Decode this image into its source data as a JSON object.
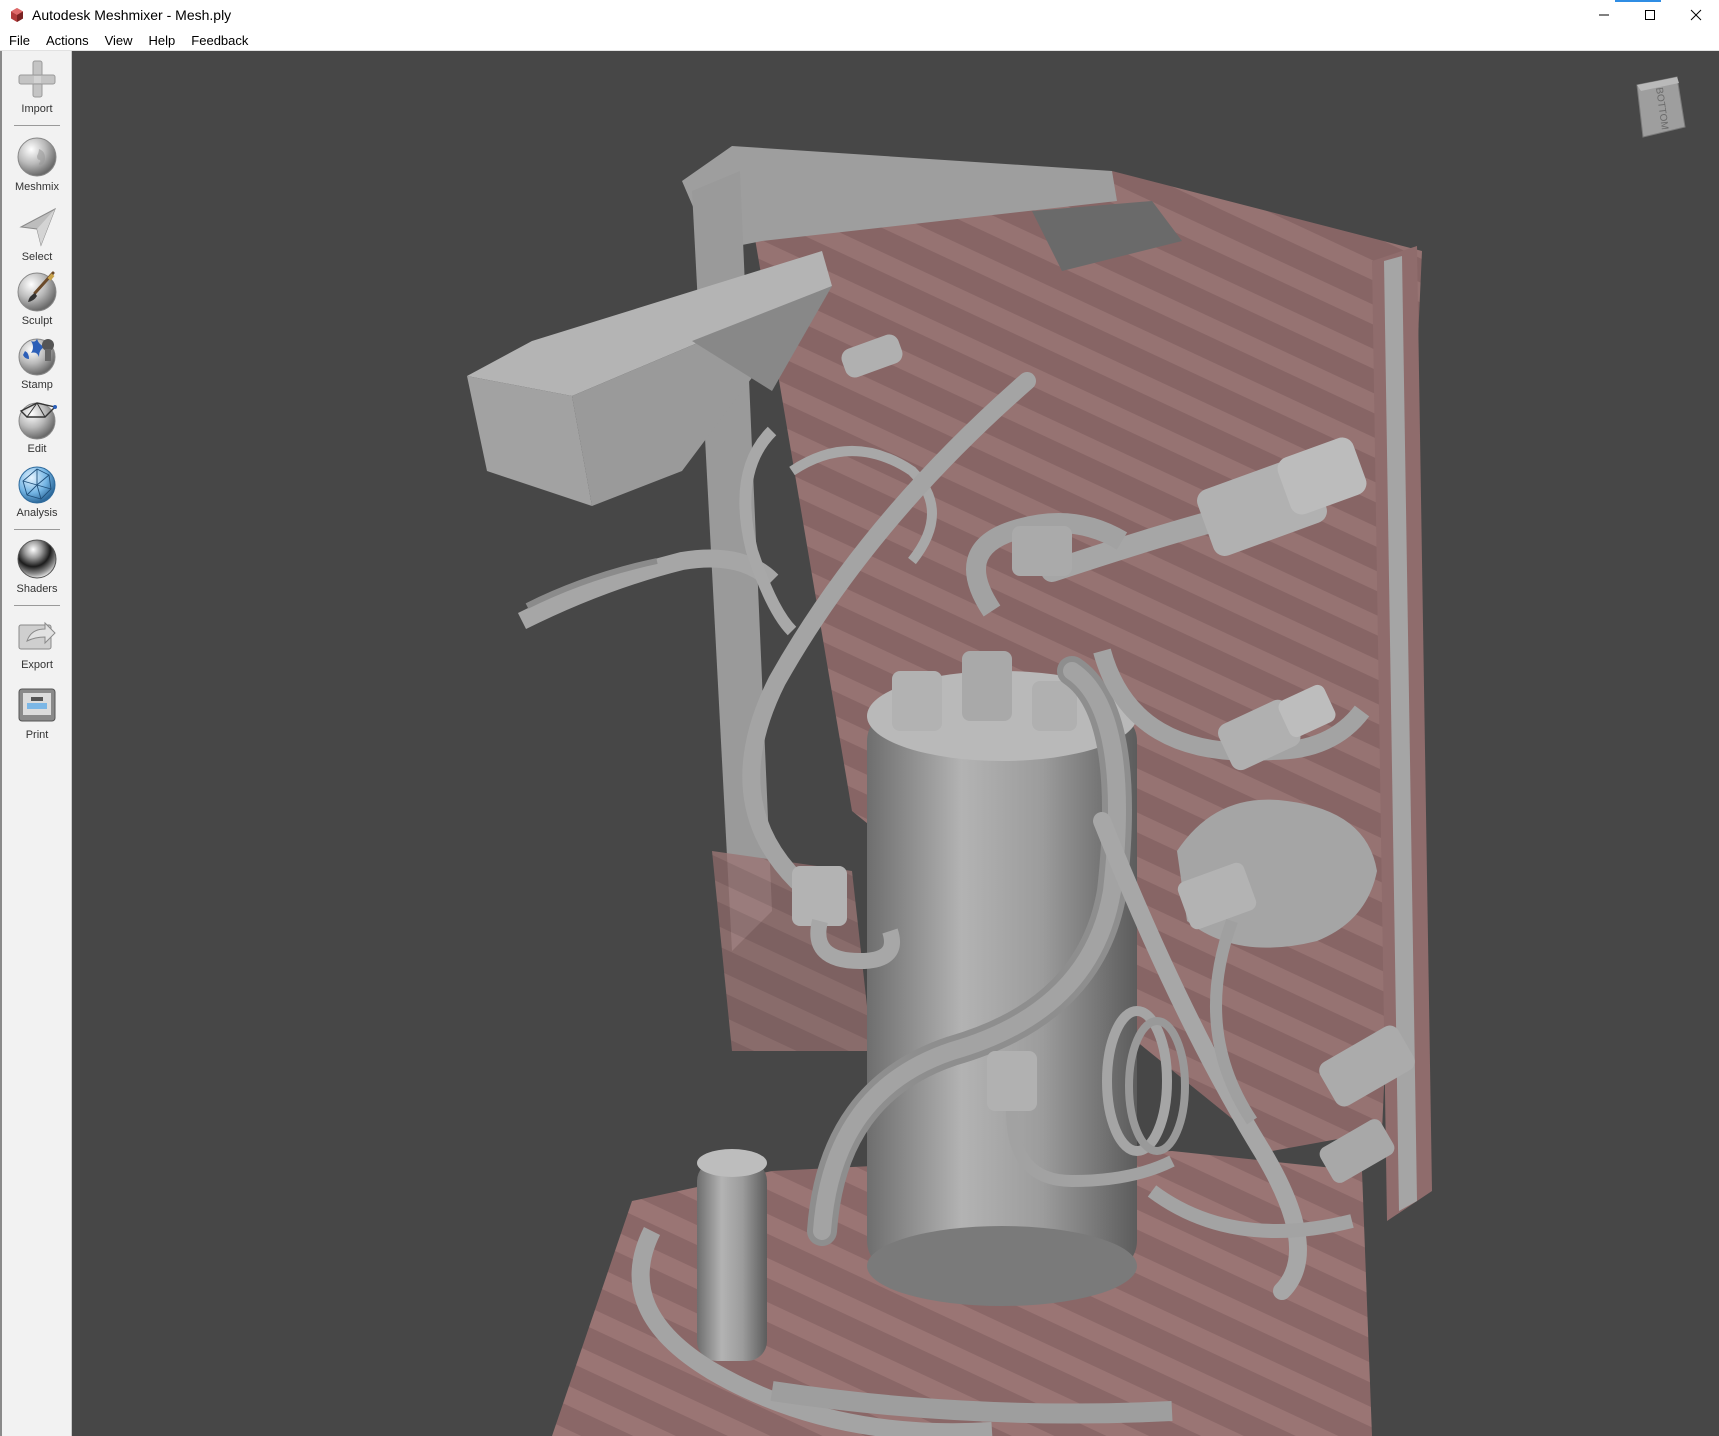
{
  "window": {
    "title": "Autodesk Meshmixer - Mesh.ply",
    "icon": "meshmixer-app-icon",
    "controls": [
      "minimize-icon",
      "maximize-icon",
      "close-icon"
    ]
  },
  "menu": {
    "items": [
      "File",
      "Actions",
      "View",
      "Help",
      "Feedback"
    ]
  },
  "toolbar": {
    "tools": [
      {
        "label": "Import",
        "icon": "plus-icon"
      },
      {
        "label": "Meshmix",
        "icon": "meshmix-head-icon"
      },
      {
        "label": "Select",
        "icon": "arrow-cursor-icon"
      },
      {
        "label": "Sculpt",
        "icon": "brush-sphere-icon"
      },
      {
        "label": "Stamp",
        "icon": "stamp-icon"
      },
      {
        "label": "Edit",
        "icon": "edit-sphere-icon"
      },
      {
        "label": "Analysis",
        "icon": "mesh-sphere-icon"
      },
      {
        "label": "Shaders",
        "icon": "chrome-sphere-icon"
      },
      {
        "label": "Export",
        "icon": "export-icon"
      },
      {
        "label": "Print",
        "icon": "printer-icon"
      }
    ]
  },
  "viewport": {
    "background": "#474747",
    "mesh_color": "#a8a8a8",
    "backface_color": "#8e6464",
    "viewcube_label": "BOTTOM"
  }
}
